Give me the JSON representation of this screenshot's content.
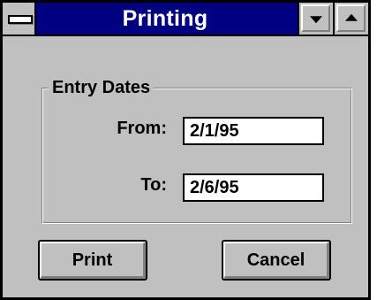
{
  "window": {
    "title": "Printing"
  },
  "titlebar": {
    "system_menu_icon": "system-menu-icon",
    "minimize_icon": "minimize-arrow-icon",
    "maximize_icon": "maximize-arrow-icon"
  },
  "entry_dates": {
    "group_label": "Entry Dates",
    "from_label": "From:",
    "from_value": "2/1/95",
    "to_label": "To:",
    "to_value": "2/6/95"
  },
  "buttons": {
    "print_label": "Print",
    "cancel_label": "Cancel"
  },
  "colors": {
    "title_bar": "#000080",
    "dialog_face": "#c0c0c0",
    "field_background": "#ffffff"
  }
}
